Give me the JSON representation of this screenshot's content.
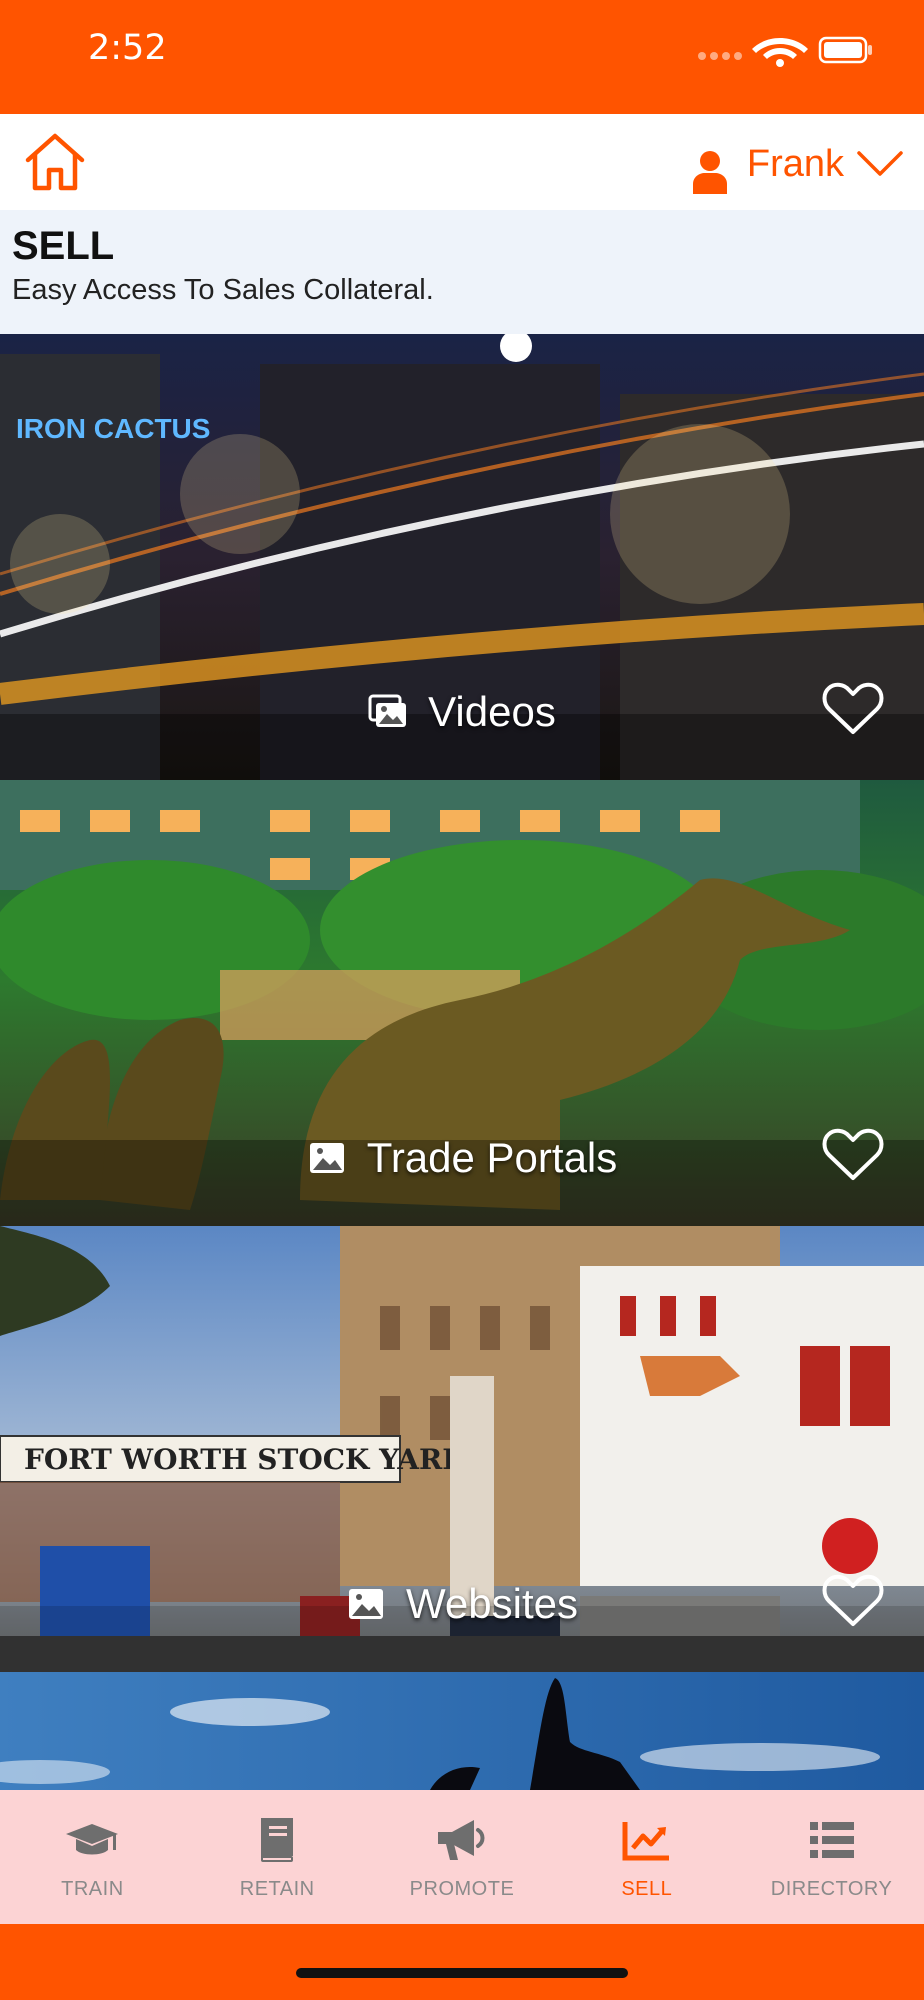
{
  "status_bar": {
    "time": "2:52"
  },
  "header": {
    "user_name": "Frank"
  },
  "section": {
    "title": "SELL",
    "subtitle": "Easy Access To Sales Collateral."
  },
  "cards": [
    {
      "label": "Videos",
      "icon": "images-icon"
    },
    {
      "label": "Trade Portals",
      "icon": "image-icon"
    },
    {
      "label": "Websites",
      "icon": "image-icon"
    }
  ],
  "bottom_nav": [
    {
      "label": "TRAIN",
      "icon": "graduation-cap-icon",
      "active": false
    },
    {
      "label": "RETAIN",
      "icon": "book-icon",
      "active": false
    },
    {
      "label": "PROMOTE",
      "icon": "megaphone-icon",
      "active": false
    },
    {
      "label": "SELL",
      "icon": "chart-line-icon",
      "active": true
    },
    {
      "label": "DIRECTORY",
      "icon": "list-icon",
      "active": false
    }
  ],
  "colors": {
    "accent": "#ff5400",
    "nav_bg": "#fcd3d4",
    "nav_inactive": "#8a8a8a",
    "section_bg": "#eef3fa"
  }
}
